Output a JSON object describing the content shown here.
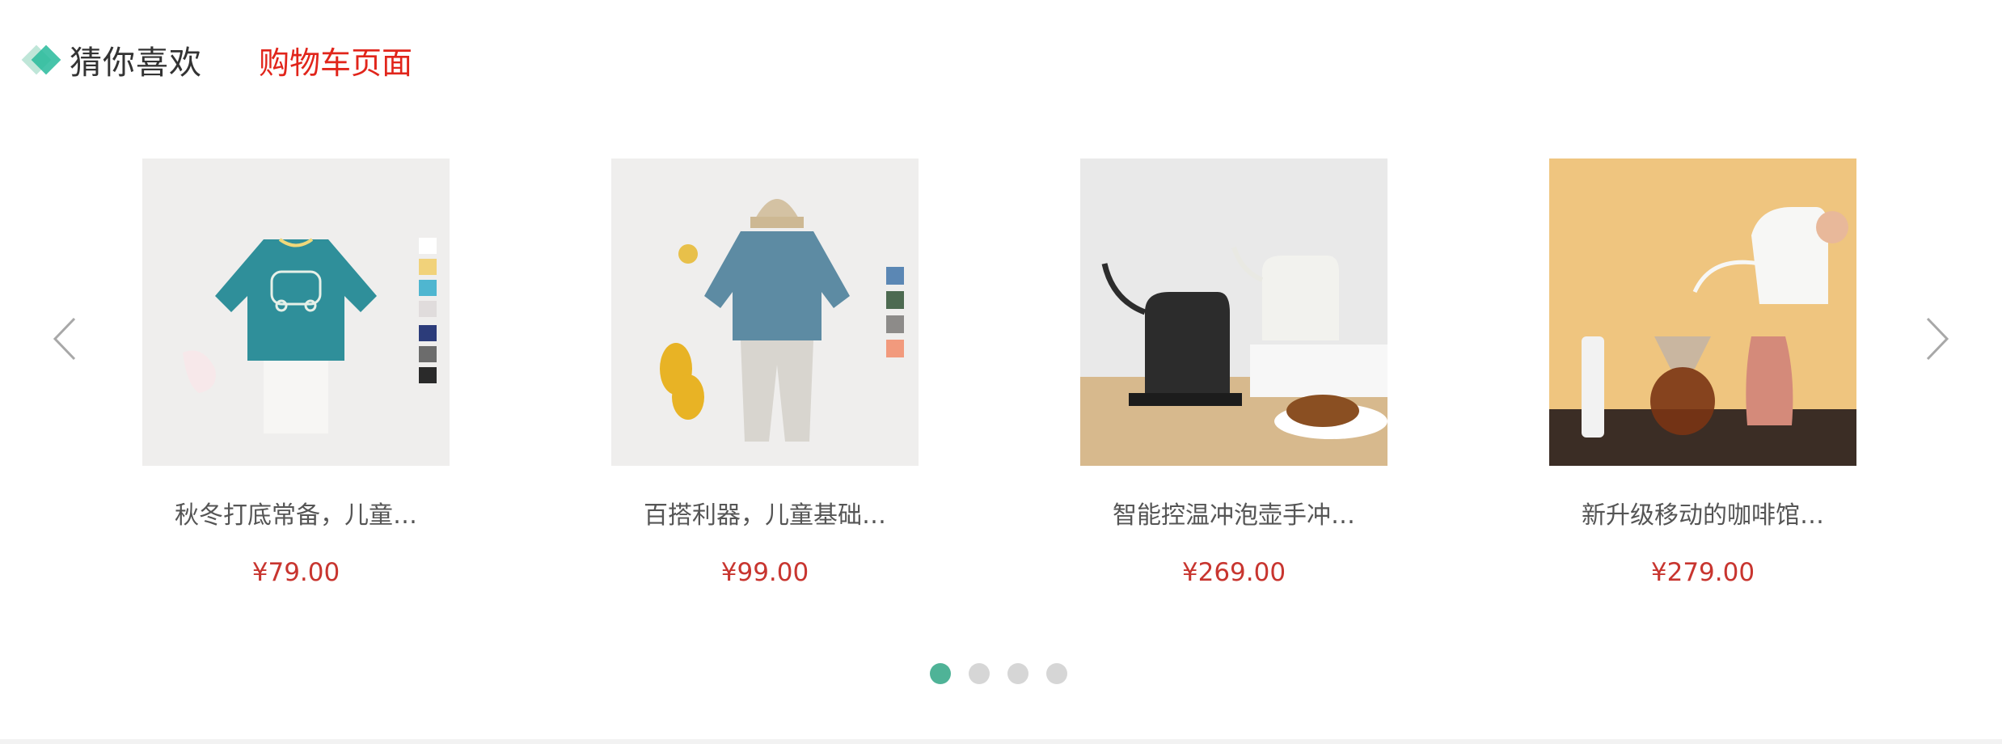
{
  "header": {
    "title": "猜你喜欢",
    "cart_link": "购物车页面"
  },
  "carousel": {
    "prev_icon": "chevron-left-icon",
    "next_icon": "chevron-right-icon",
    "products": [
      {
        "name": "秋冬打底常备，儿童…",
        "price": "¥79.00",
        "image": "kids-teal-car-sweater"
      },
      {
        "name": "百搭利器，儿童基础…",
        "price": "¥99.00",
        "image": "kids-blue-knit-outfit"
      },
      {
        "name": "智能控温冲泡壶手冲…",
        "price": "¥269.00",
        "image": "kettle-black-white"
      },
      {
        "name": "新升级移动的咖啡馆…",
        "price": "¥279.00",
        "image": "pour-over-coffee-set"
      }
    ],
    "dots": {
      "count": 4,
      "active_index": 0
    }
  },
  "colors": {
    "accent": "#27ba9b",
    "active_dot": "#4fb397",
    "price": "#c8352f",
    "cart_link": "#e1251b"
  }
}
